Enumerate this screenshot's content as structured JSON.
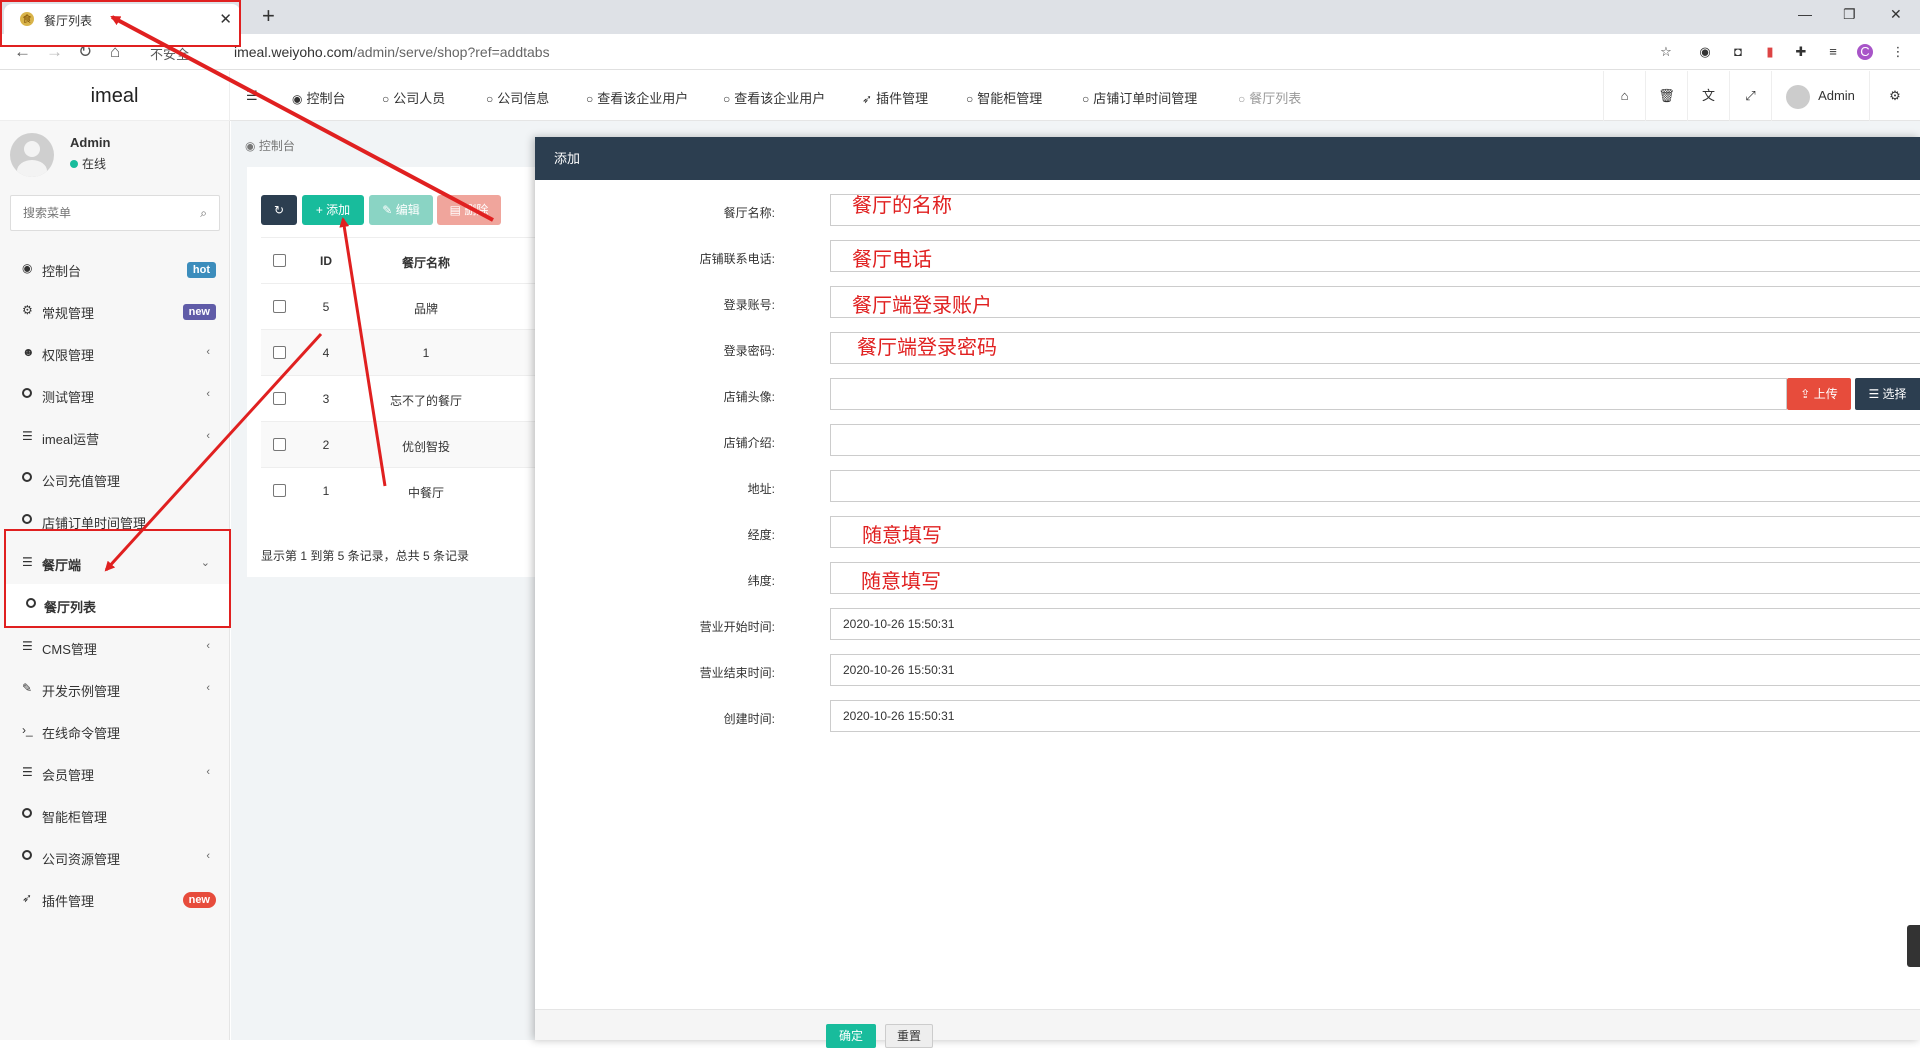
{
  "browser": {
    "tab_title": "餐厅列表",
    "insecure_label": "不安全",
    "url_host": "imeal.weiyoho.com",
    "url_path": "/admin/serve/shop?ref=addtabs",
    "profile_initial": "C"
  },
  "header": {
    "logo": "imeal",
    "nav": [
      {
        "label": "控制台",
        "icon": "dashboard-icon"
      },
      {
        "label": "公司人员",
        "icon": "circle-icon"
      },
      {
        "label": "公司信息",
        "icon": "circle-icon"
      },
      {
        "label": "查看该企业用户",
        "icon": "circle-icon"
      },
      {
        "label": "查看该企业用户",
        "icon": "circle-icon"
      },
      {
        "label": "插件管理",
        "icon": "rocket-icon"
      },
      {
        "label": "智能柜管理",
        "icon": "circle-icon"
      },
      {
        "label": "店铺订单时间管理",
        "icon": "circle-icon"
      },
      {
        "label": "餐厅列表",
        "icon": "circle-icon"
      }
    ],
    "admin_label": "Admin"
  },
  "sidebar": {
    "user_name": "Admin",
    "user_status": "在线",
    "search_placeholder": "搜索菜单",
    "items": [
      {
        "label": "控制台",
        "icon": "dashboard-icon",
        "badge": "hot"
      },
      {
        "label": "常规管理",
        "icon": "cogs-icon",
        "badge": "new"
      },
      {
        "label": "权限管理",
        "icon": "users-icon"
      },
      {
        "label": "测试管理",
        "icon": "circle-icon"
      },
      {
        "label": "imeal运营",
        "icon": "list-icon"
      },
      {
        "label": "公司充值管理",
        "icon": "circle-icon"
      },
      {
        "label": "店铺订单时间管理",
        "icon": "circle-icon"
      },
      {
        "label": "餐厅端",
        "icon": "list-icon"
      },
      {
        "label": "餐厅列表",
        "icon": "circle-icon"
      },
      {
        "label": "CMS管理",
        "icon": "list-icon"
      },
      {
        "label": "开发示例管理",
        "icon": "magic-icon"
      },
      {
        "label": "在线命令管理",
        "icon": "terminal-icon"
      },
      {
        "label": "会员管理",
        "icon": "list-icon"
      },
      {
        "label": "智能柜管理",
        "icon": "circle-icon"
      },
      {
        "label": "公司资源管理",
        "icon": "circle-icon"
      },
      {
        "label": "插件管理",
        "icon": "rocket-icon",
        "badge": "new"
      }
    ]
  },
  "main": {
    "breadcrumb": "控制台",
    "toolbar": {
      "add": "添加",
      "edit": "编辑",
      "delete": "删除"
    },
    "table": {
      "headers": [
        "ID",
        "餐厅名称"
      ],
      "rows": [
        {
          "id": "5",
          "name": "品牌"
        },
        {
          "id": "4",
          "name": "1"
        },
        {
          "id": "3",
          "name": "忘不了的餐厅"
        },
        {
          "id": "2",
          "name": "优创智投"
        },
        {
          "id": "1",
          "name": "中餐厅"
        }
      ]
    },
    "pager": "显示第 1 到第 5 条记录，总共 5 条记录"
  },
  "modal": {
    "title": "添加",
    "fields": [
      {
        "label": "餐厅名称:",
        "value": "",
        "note": "餐厅的名称"
      },
      {
        "label": "店铺联系电话:",
        "value": "",
        "note": "餐厅电话"
      },
      {
        "label": "登录账号:",
        "value": "",
        "note": "餐厅端登录账户"
      },
      {
        "label": "登录密码:",
        "value": "",
        "note": "餐厅端登录密码"
      },
      {
        "label": "店铺头像:",
        "value": "",
        "note": ""
      },
      {
        "label": "店铺介绍:",
        "value": "",
        "note": ""
      },
      {
        "label": "地址:",
        "value": "",
        "note": ""
      },
      {
        "label": "经度:",
        "value": "",
        "note": "随意填写"
      },
      {
        "label": "纬度:",
        "value": "",
        "note": "随意填写"
      },
      {
        "label": "营业开始时间:",
        "value": "2020-10-26 15:50:31",
        "note": ""
      },
      {
        "label": "营业结束时间:",
        "value": "2020-10-26 15:50:31",
        "note": ""
      },
      {
        "label": "创建时间:",
        "value": "2020-10-26 15:50:31",
        "note": ""
      }
    ],
    "upload": "上传",
    "select": "选择",
    "confirm": "确定",
    "reset": "重置"
  },
  "colors": {
    "accent": "#18bc9c",
    "dark": "#2c3e50",
    "danger": "#e74c3c",
    "annotation": "#e02020"
  }
}
